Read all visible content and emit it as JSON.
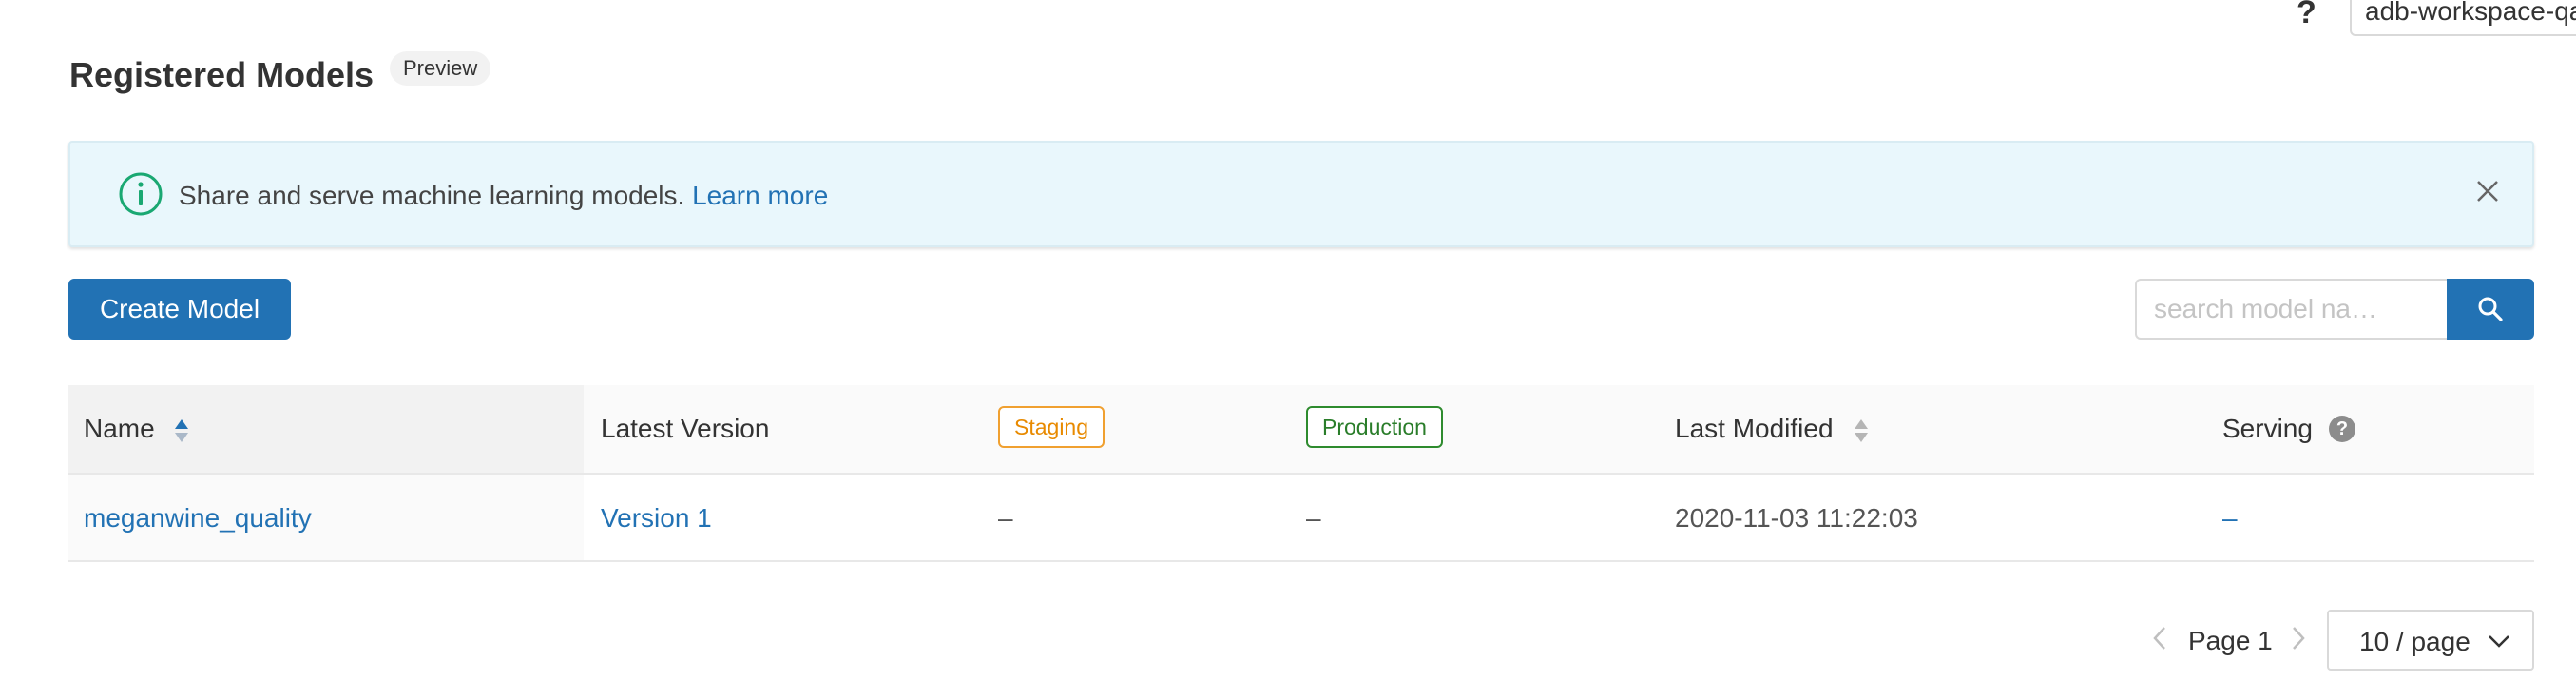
{
  "header": {
    "help_label": "?",
    "workspace_name": "adb-workspace-qa"
  },
  "page": {
    "title": "Registered Models",
    "badge": "Preview"
  },
  "banner": {
    "text": "Share and serve machine learning models.",
    "link_text": "Learn more",
    "icon": "info-circle-icon"
  },
  "toolbar": {
    "create_label": "Create Model",
    "search_placeholder": "search model na…",
    "search_value": ""
  },
  "table": {
    "columns": {
      "name": "Name",
      "latest_version": "Latest Version",
      "staging": "Staging",
      "production": "Production",
      "last_modified": "Last Modified",
      "serving": "Serving"
    },
    "rows": [
      {
        "name": "meganwine_quality",
        "latest_version": "Version 1",
        "staging": "–",
        "production": "–",
        "last_modified": "2020-11-03 11:22:03",
        "serving": "–"
      }
    ]
  },
  "pagination": {
    "page_label": "Page 1",
    "page_size": "10 / page"
  },
  "colors": {
    "primary": "#2272b4",
    "banner_bg": "#e9f7fc",
    "info_green": "#1aa872",
    "staging": "#e88a00",
    "production": "#2a7d2a"
  }
}
